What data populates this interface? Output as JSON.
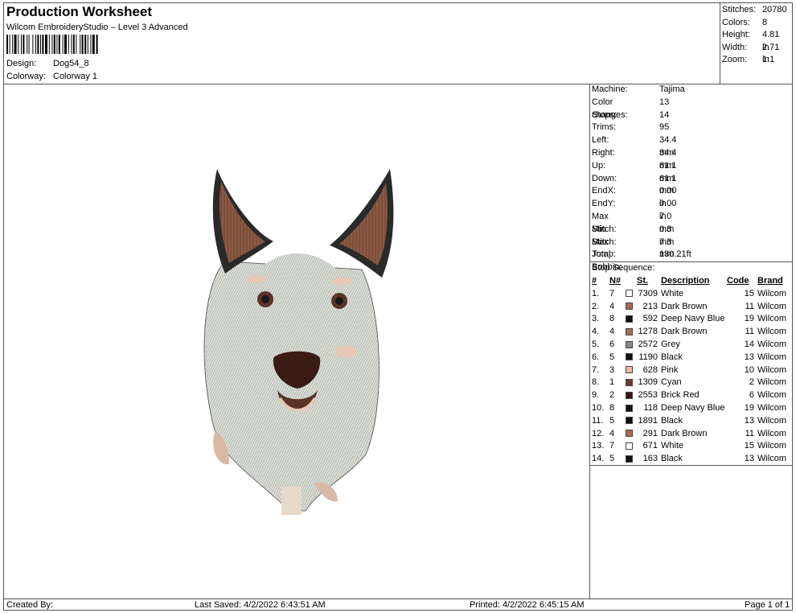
{
  "header": {
    "title": "Production Worksheet",
    "subtitle": "Wilcom EmbroideryStudio – Level 3 Advanced",
    "design_label": "Design:",
    "design_value": "Dog54_8",
    "colorway_label": "Colorway:",
    "colorway_value": "Colorway 1"
  },
  "summary": [
    {
      "label": "Stitches:",
      "value": "20780"
    },
    {
      "label": "Colors:",
      "value": "8"
    },
    {
      "label": "Height:",
      "value": "4.81 in"
    },
    {
      "label": "Width:",
      "value": "2.71 in"
    },
    {
      "label": "Zoom:",
      "value": "1:1"
    }
  ],
  "machine_stats": [
    {
      "label": "Machine:",
      "value": "Tajima"
    },
    {
      "label": "Color changes:",
      "value": "13"
    },
    {
      "label": "Stops:",
      "value": "14"
    },
    {
      "label": "Trims:",
      "value": "95"
    },
    {
      "label": "Left:",
      "value": "34.4 mm"
    },
    {
      "label": "Right:",
      "value": "34.4 mm"
    },
    {
      "label": "Up:",
      "value": "61.1 mm"
    },
    {
      "label": "Down:",
      "value": "61.1 mm"
    },
    {
      "label": "EndX:",
      "value": "0.00 in"
    },
    {
      "label": "EndY:",
      "value": "0.00 in"
    },
    {
      "label": "Max Stitch:",
      "value": "7.0 mm"
    },
    {
      "label": "Min Stitch:",
      "value": "0.3 mm"
    },
    {
      "label": "Max Jump:",
      "value": "7.3 mm"
    },
    {
      "label": "Total Bobbin:",
      "value": "130.21ft"
    }
  ],
  "stop_sequence": {
    "heading": "Stop Sequence:",
    "columns": [
      "#",
      "N#",
      "St.",
      "Description",
      "Code",
      "Brand"
    ],
    "rows": [
      {
        "idx": "1.",
        "n": "7",
        "color": "#ffffff",
        "st": "7309",
        "desc": "White",
        "code": "15",
        "brand": "Wilcom"
      },
      {
        "idx": "2.",
        "n": "4",
        "color": "#a86a5a",
        "st": "213",
        "desc": "Dark Brown",
        "code": "11",
        "brand": "Wilcom"
      },
      {
        "idx": "3.",
        "n": "8",
        "color": "#111111",
        "st": "592",
        "desc": "Deep Navy Blue",
        "code": "19",
        "brand": "Wilcom"
      },
      {
        "idx": "4.",
        "n": "4",
        "color": "#a86a5a",
        "st": "1278",
        "desc": "Dark Brown",
        "code": "11",
        "brand": "Wilcom"
      },
      {
        "idx": "5.",
        "n": "6",
        "color": "#888888",
        "st": "2572",
        "desc": "Grey",
        "code": "14",
        "brand": "Wilcom"
      },
      {
        "idx": "6.",
        "n": "5",
        "color": "#111111",
        "st": "1190",
        "desc": "Black",
        "code": "13",
        "brand": "Wilcom"
      },
      {
        "idx": "7.",
        "n": "3",
        "color": "#f0b8a8",
        "st": "628",
        "desc": "Pink",
        "code": "10",
        "brand": "Wilcom"
      },
      {
        "idx": "8.",
        "n": "1",
        "color": "#6b3a2e",
        "st": "1309",
        "desc": "Cyan",
        "code": "2",
        "brand": "Wilcom"
      },
      {
        "idx": "9.",
        "n": "2",
        "color": "#3a1510",
        "st": "2553",
        "desc": "Brick Red",
        "code": "6",
        "brand": "Wilcom"
      },
      {
        "idx": "10.",
        "n": "8",
        "color": "#111111",
        "st": "118",
        "desc": "Deep Navy Blue",
        "code": "19",
        "brand": "Wilcom"
      },
      {
        "idx": "11.",
        "n": "5",
        "color": "#111111",
        "st": "1891",
        "desc": "Black",
        "code": "13",
        "brand": "Wilcom"
      },
      {
        "idx": "12.",
        "n": "4",
        "color": "#a86a5a",
        "st": "291",
        "desc": "Dark Brown",
        "code": "11",
        "brand": "Wilcom"
      },
      {
        "idx": "13.",
        "n": "7",
        "color": "#ffffff",
        "st": "671",
        "desc": "White",
        "code": "15",
        "brand": "Wilcom"
      },
      {
        "idx": "14.",
        "n": "5",
        "color": "#111111",
        "st": "163",
        "desc": "Black",
        "code": "13",
        "brand": "Wilcom"
      }
    ]
  },
  "footer": {
    "created_by": "Created By:",
    "last_saved": "Last Saved: 4/2/2022 6:43:51 AM",
    "printed": "Printed: 4/2/2022 6:45:15 AM",
    "page": "Page 1 of 1"
  }
}
